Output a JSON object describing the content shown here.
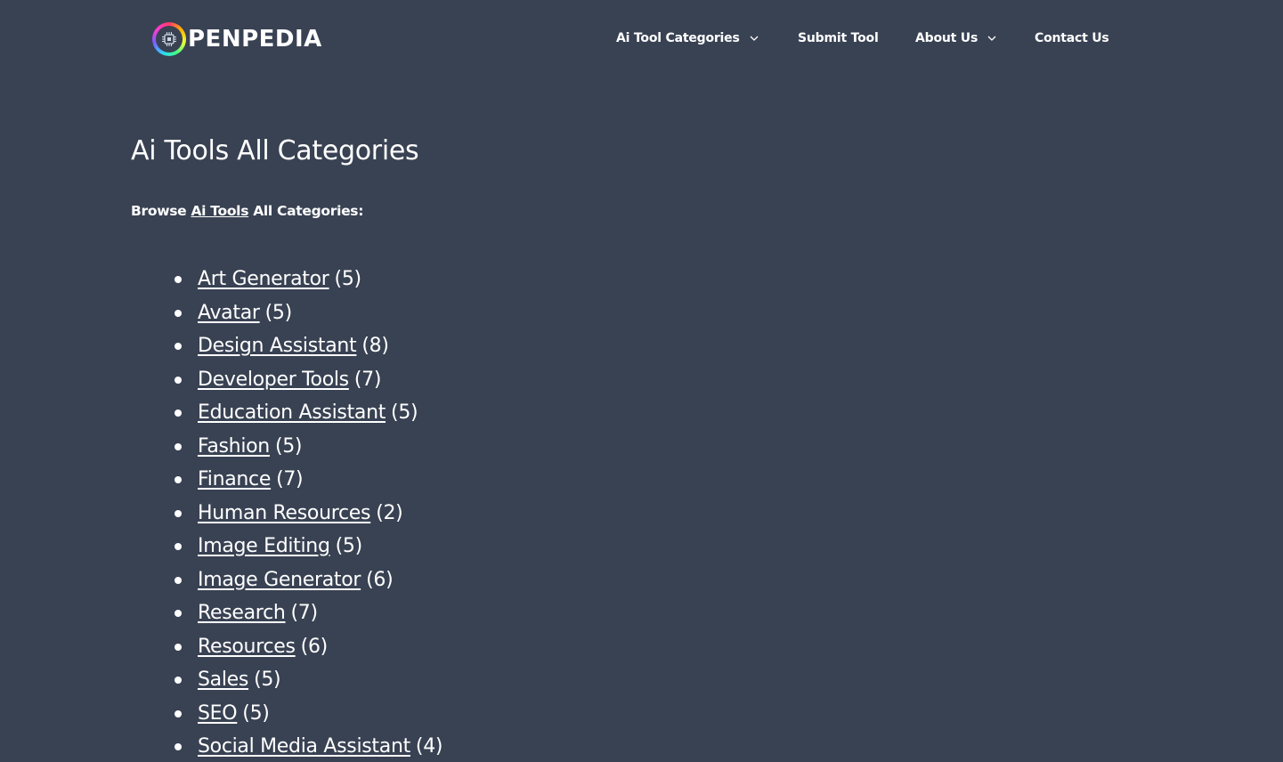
{
  "header": {
    "logo_text": "PENPEDIA",
    "nav": [
      {
        "label": "Ai Tool Categories",
        "has_dropdown": true
      },
      {
        "label": "Submit Tool",
        "has_dropdown": false
      },
      {
        "label": "About Us",
        "has_dropdown": true
      },
      {
        "label": "Contact Us",
        "has_dropdown": false
      }
    ]
  },
  "main": {
    "title": "Ai Tools All Categories",
    "intro_before": "Browse ",
    "intro_link": "Ai Tools",
    "intro_after": " All Categories:",
    "categories": [
      {
        "name": "Art Generator",
        "count": "(5)"
      },
      {
        "name": "Avatar",
        "count": "(5)"
      },
      {
        "name": "Design Assistant",
        "count": "(8)"
      },
      {
        "name": "Developer Tools",
        "count": "(7)"
      },
      {
        "name": "Education Assistant",
        "count": "(5)"
      },
      {
        "name": "Fashion",
        "count": "(5)"
      },
      {
        "name": "Finance",
        "count": "(7)"
      },
      {
        "name": "Human Resources",
        "count": "(2)"
      },
      {
        "name": "Image Editing",
        "count": "(5)"
      },
      {
        "name": "Image Generator",
        "count": "(6)"
      },
      {
        "name": "Research",
        "count": "(7)"
      },
      {
        "name": "Resources",
        "count": "(6)"
      },
      {
        "name": "Sales",
        "count": "(5)"
      },
      {
        "name": "SEO",
        "count": "(5)"
      },
      {
        "name": "Social Media Assistant",
        "count": "(4)"
      }
    ]
  },
  "colors": {
    "background": "#394253",
    "text": "#ffffff"
  },
  "icons": {
    "logo": "chip-ring-logo-icon",
    "dropdown": "chevron-down-icon",
    "bullet": "bullet-dot-icon"
  }
}
